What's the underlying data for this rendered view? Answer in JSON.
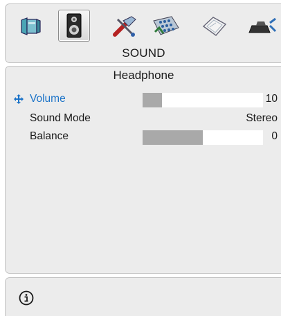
{
  "menu": {
    "title": "SOUND",
    "icons": [
      {
        "name": "picture-icon"
      },
      {
        "name": "sound-icon",
        "selected": true
      },
      {
        "name": "tools-icon"
      },
      {
        "name": "channel-setup-icon"
      },
      {
        "name": "manual-icon"
      },
      {
        "name": "network-icon"
      }
    ]
  },
  "submenu": {
    "title": "Headphone",
    "items": [
      {
        "label": "Volume",
        "value": "10",
        "level": 0.16,
        "selected": true
      },
      {
        "label": "Sound Mode",
        "value": "Stereo"
      },
      {
        "label": "Balance",
        "value": "0",
        "level": 0.5
      }
    ]
  },
  "footer": {
    "icon": "info-icon"
  },
  "colors": {
    "highlight": "#1b73c8",
    "bar_fill": "#a9a9a9",
    "panel": "#ececec"
  }
}
